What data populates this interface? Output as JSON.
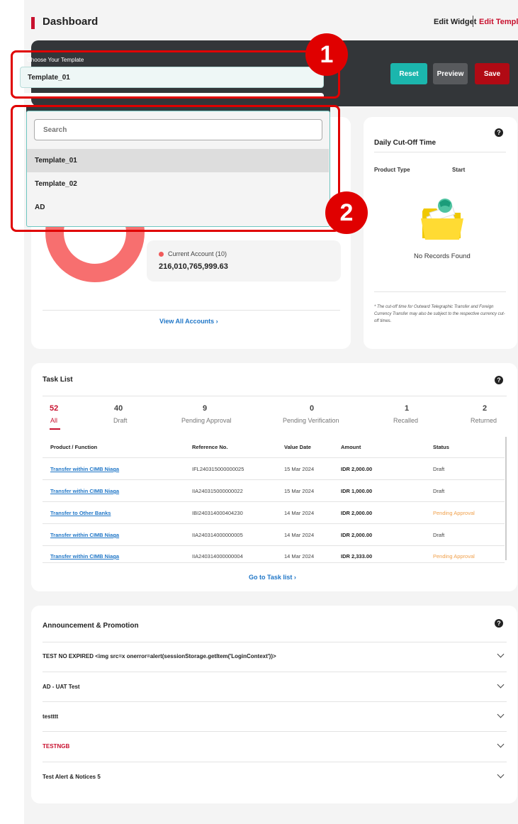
{
  "header": {
    "title": "Dashboard",
    "edit_widget": "Edit Widget",
    "edit_template": "Edit Template"
  },
  "toolbar": {
    "choose_label": "Choose Your Template",
    "selected_template": "Template_01",
    "reset": "Reset",
    "preview": "Preview",
    "save": "Save"
  },
  "dropdown": {
    "search_placeholder": "Search",
    "options": [
      "Template_01",
      "Template_02",
      "AD"
    ]
  },
  "annotations": {
    "one": "1",
    "two": "2"
  },
  "accounts": {
    "current_account_label": "Current Account (10)",
    "current_account_amount": "216,010,765,999.63",
    "view_all": "View All Accounts ›"
  },
  "cutoff": {
    "title": "Daily Cut-Off Time",
    "col_product": "Product Type",
    "col_start": "Start",
    "empty": "No Records Found",
    "note": "* The cut-off time for Outward Telegraphic Transfer and Foreign Currency Transfer may also be subject to the respective currency cut-off times."
  },
  "tasks": {
    "title": "Task List",
    "tabs": [
      {
        "count": "52",
        "label": "All"
      },
      {
        "count": "40",
        "label": "Draft"
      },
      {
        "count": "9",
        "label": "Pending Approval"
      },
      {
        "count": "0",
        "label": "Pending Verification"
      },
      {
        "count": "1",
        "label": "Recalled"
      },
      {
        "count": "2",
        "label": "Returned"
      }
    ],
    "columns": [
      "Product / Function",
      "Reference No.",
      "Value Date",
      "Amount",
      "Status"
    ],
    "rows": [
      {
        "product": "Transfer within CIMB Niaga",
        "ref": "IFL240315000000025",
        "date": "15 Mar 2024",
        "amount": "IDR 2,000.00",
        "status": "Draft"
      },
      {
        "product": "Transfer within CIMB Niaga",
        "ref": "IIA240315000000022",
        "date": "15 Mar 2024",
        "amount": "IDR 1,000.00",
        "status": "Draft"
      },
      {
        "product": "Transfer to Other Banks",
        "ref": "IBI240314000404230",
        "date": "14 Mar 2024",
        "amount": "IDR 2,000.00",
        "status": "Pending Approval"
      },
      {
        "product": "Transfer within CIMB Niaga",
        "ref": "IIA240314000000005",
        "date": "14 Mar 2024",
        "amount": "IDR 2,000.00",
        "status": "Draft"
      },
      {
        "product": "Transfer within CIMB Niaga",
        "ref": "IIA240314000000004",
        "date": "14 Mar 2024",
        "amount": "IDR 2,333.00",
        "status": "Pending Approval"
      }
    ],
    "go_to": "Go to Task list ›"
  },
  "announcements": {
    "title": "Announcement & Promotion",
    "items": [
      "TEST NO EXPIRED <img src=x onerror=alert(sessionStorage.getItem('LoginContext'))>",
      "AD - UAT Test",
      "testttt",
      "TESTNGB",
      "Test Alert & Notices 5"
    ]
  },
  "colors": {
    "brand_red": "#c8102e",
    "teal": "#1bb6ad",
    "dark": "#333639",
    "link_blue": "#1f76c7",
    "pending_orange": "#f0a04b",
    "donut": "#f76f6f"
  }
}
